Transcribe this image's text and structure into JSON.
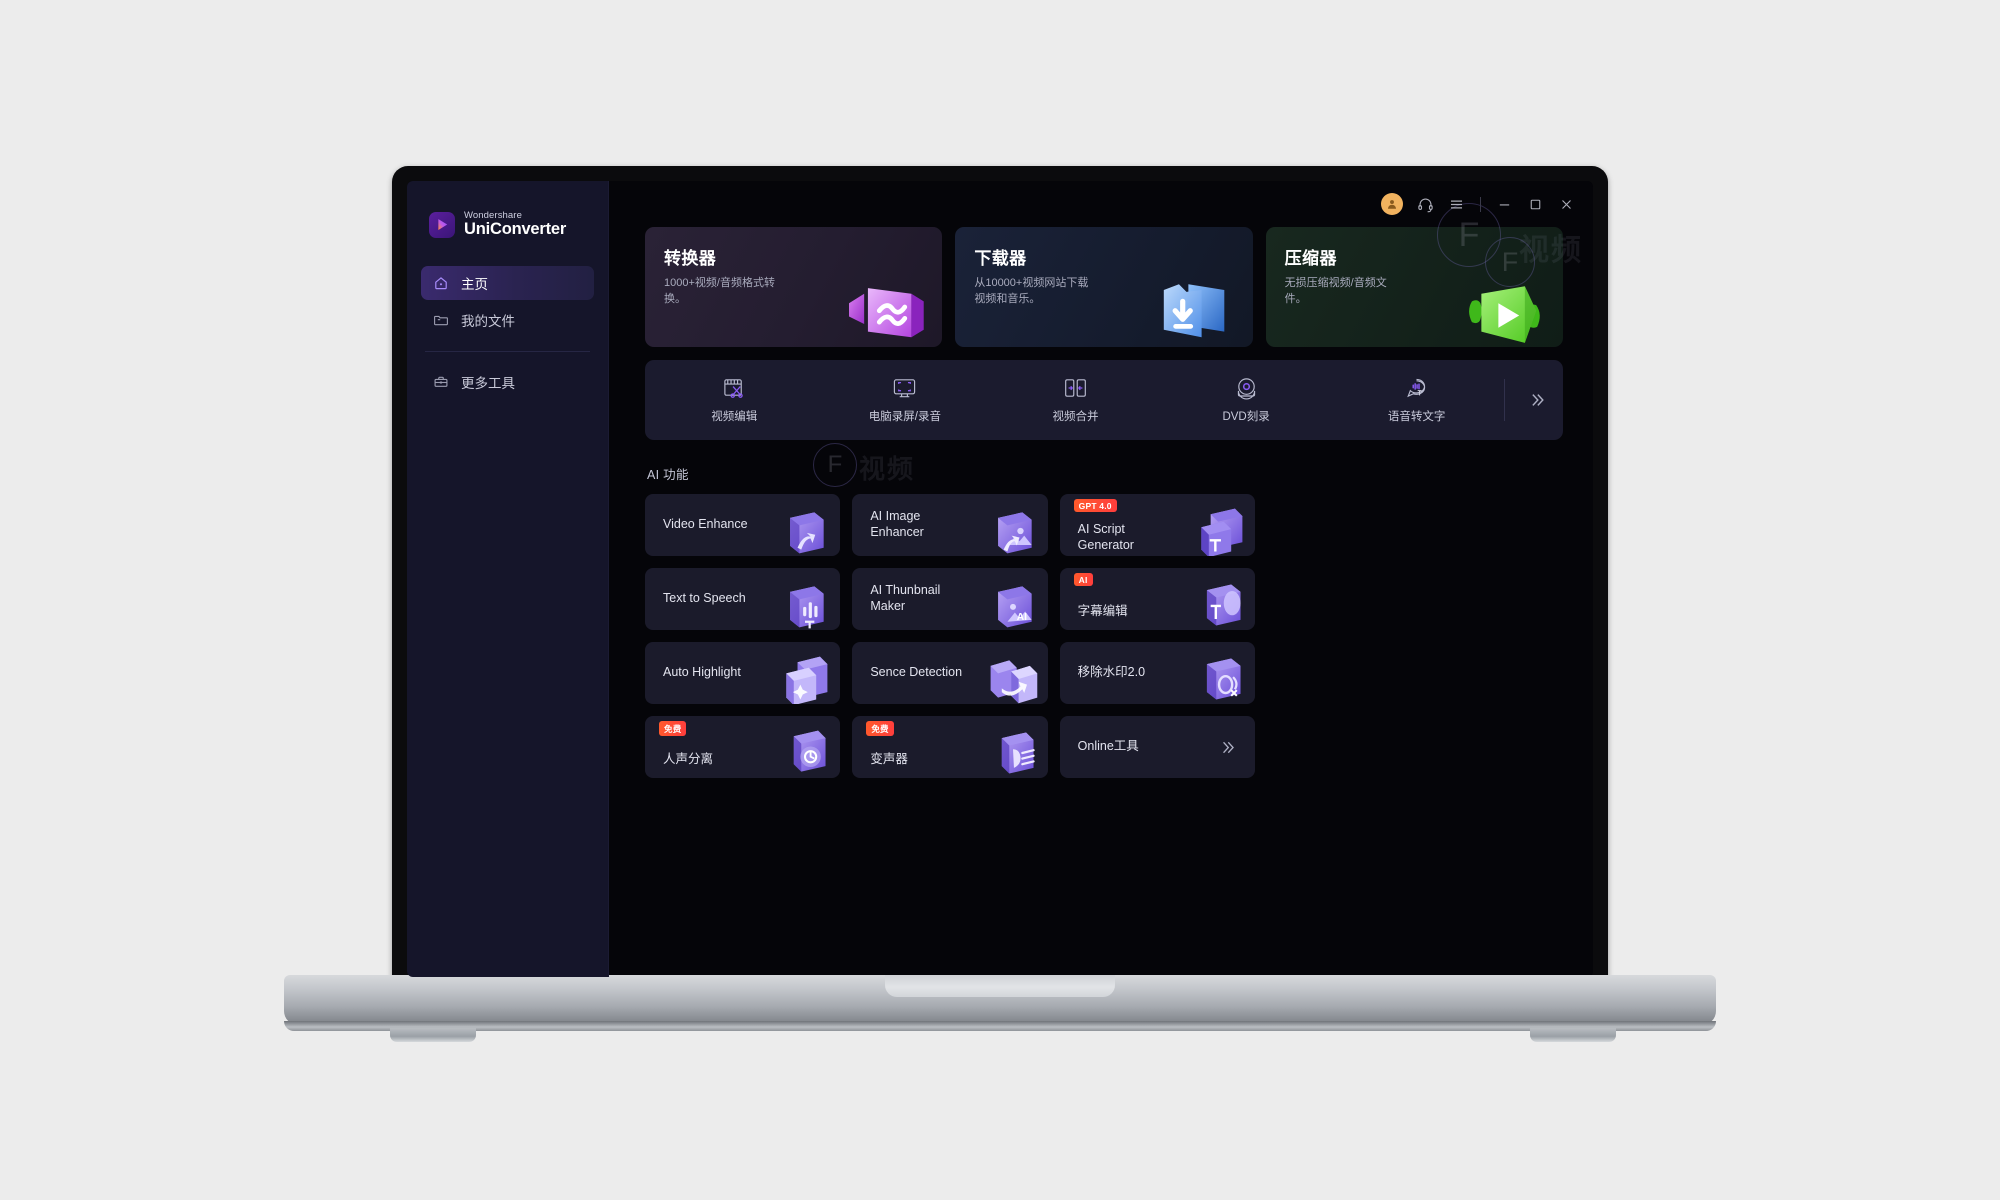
{
  "window": {
    "titlebar": {
      "avatar_icon": "user-avatar-icon",
      "support_icon": "headset-icon",
      "menu_icon": "hamburger-menu-icon",
      "minimize_icon": "minimize-icon",
      "maximize_icon": "maximize-icon",
      "close_icon": "close-icon"
    }
  },
  "sidebar": {
    "brand": {
      "sup": "Wondershare",
      "name": "UniConverter",
      "logo_icon": "uniconverter-logo-icon"
    },
    "items": [
      {
        "label": "主页",
        "icon": "home-icon",
        "active": true
      },
      {
        "label": "我的文件",
        "icon": "folder-icon",
        "active": false
      },
      {
        "label": "更多工具",
        "icon": "toolbox-icon",
        "active": false
      }
    ]
  },
  "hero_cards": [
    {
      "title": "转换器",
      "desc": "1000+视频/音频格式转换。",
      "icon": "converter-video-icon",
      "accent": "#c96be0"
    },
    {
      "title": "下载器",
      "desc": "从10000+视频网站下载视频和音乐。",
      "icon": "downloader-arrow-icon",
      "accent": "#5da0f5"
    },
    {
      "title": "压缩器",
      "desc": "无损压缩视频/音频文件。",
      "icon": "compressor-play-icon",
      "accent": "#67d53c"
    }
  ],
  "tools": [
    {
      "label": "视频编辑",
      "icon": "video-edit-scissors-icon"
    },
    {
      "label": "电脑录屏/录音",
      "icon": "screen-record-icon"
    },
    {
      "label": "视频合并",
      "icon": "video-merge-icon"
    },
    {
      "label": "DVD刻录",
      "icon": "dvd-burn-icon"
    },
    {
      "label": "语音转文字",
      "icon": "speech-to-text-icon"
    }
  ],
  "tools_more_icon": "chevron-double-right-icon",
  "ai_section": {
    "heading": "AI 功能",
    "cards": [
      {
        "label": "Video Enhance",
        "badge": null,
        "icon": "video-enhance-icon"
      },
      {
        "label": "AI Image Enhancer",
        "badge": null,
        "icon": "ai-image-enhancer-icon"
      },
      {
        "label": "AI Script Generator",
        "badge": "GPT 4.0",
        "icon": "ai-script-generator-icon"
      },
      {
        "label": "Text to Speech",
        "badge": null,
        "icon": "text-to-speech-icon"
      },
      {
        "label": "AI Thunbnail Maker",
        "badge": null,
        "icon": "ai-thumbnail-maker-icon"
      },
      {
        "label": "字幕编辑",
        "badge": "AI",
        "icon": "subtitle-edit-icon"
      },
      {
        "label": "Auto Highlight",
        "badge": null,
        "icon": "auto-highlight-icon"
      },
      {
        "label": "Sence Detection",
        "badge": null,
        "icon": "scene-detection-icon"
      },
      {
        "label": "移除水印2.0",
        "badge": null,
        "icon": "watermark-remover-icon"
      },
      {
        "label": "人声分离",
        "badge": "免费",
        "icon": "vocal-remover-icon"
      },
      {
        "label": "变声器",
        "badge": "免费",
        "icon": "voice-changer-icon"
      },
      {
        "label": "Online工具",
        "badge": null,
        "icon": "online-tools-icon",
        "trailing_icon": "chevron-double-right-icon"
      }
    ]
  },
  "watermarks": {
    "glyph": "F",
    "cn_1": "视频",
    "cn_2": "视频"
  },
  "colors": {
    "sidebar_bg": "#15152a",
    "main_bg": "#050509",
    "card_bg": "#1b1b2b",
    "badge_orange": "#ff4d2b",
    "accent_purple": "#7c5cf0",
    "avatar_orange": "#f2b35f"
  }
}
